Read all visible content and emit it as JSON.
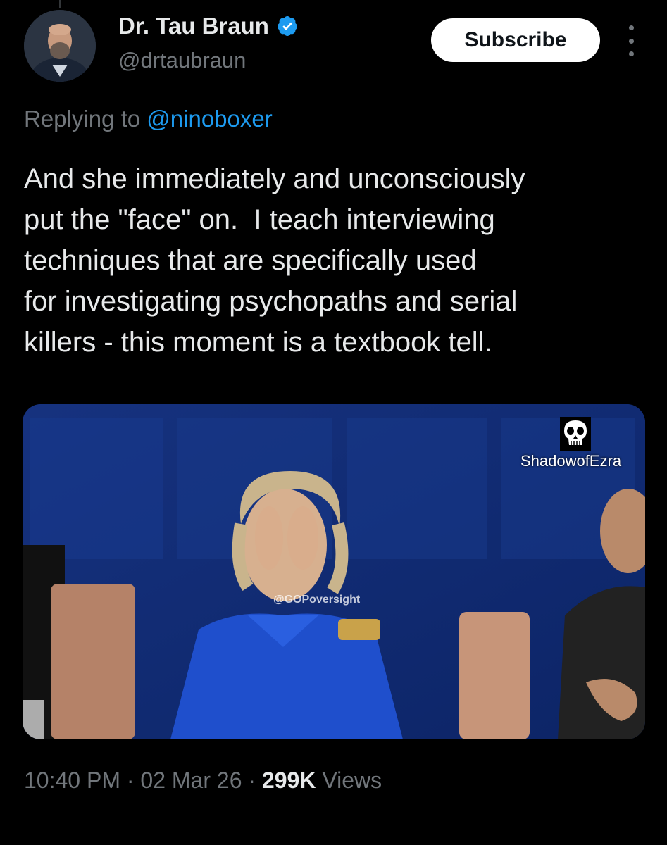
{
  "author": {
    "name": "Dr. Tau Braun",
    "handle": "@drtaubraun",
    "verified_color": "#1d9bf0"
  },
  "actions": {
    "subscribe_label": "Subscribe",
    "more_icon": "more-vertical-icon"
  },
  "reply": {
    "prefix": "Replying to",
    "target": "@ninoboxer"
  },
  "tweet": {
    "lines": [
      "And she immediately and unconsciously",
      "put the \"face\" on.  I teach interviewing",
      "techniques that are specifically used",
      "for investigating psychopaths and serial",
      "killers - this moment is a textbook tell."
    ]
  },
  "media": {
    "overlay_name": "ShadowofEzra",
    "watermark": "@GOPoversight",
    "overlay_icon": "skull-logo-icon"
  },
  "meta": {
    "time": "10:40 PM",
    "separator": "·",
    "date": "02 Mar 26",
    "views_count": "299K",
    "views_label": "Views"
  },
  "colors": {
    "background": "#000000",
    "text": "#e7e9ea",
    "secondary": "#71767b",
    "link": "#1d9bf0"
  }
}
